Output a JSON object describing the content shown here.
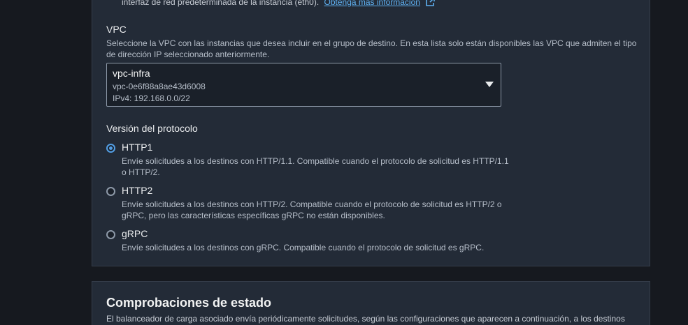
{
  "top_note": {
    "text": "interfaz de red predeterminada de la instancia (eth0).",
    "link": "Obtenga más información"
  },
  "vpc": {
    "label": "VPC",
    "description": "Seleccione la VPC con las instancias que desea incluir en el grupo de destino. En esta lista solo están disponibles las VPC que admiten el tipo de dirección IP seleccionado anteriormente.",
    "selected": {
      "name": "vpc-infra",
      "id": "vpc-0e6f88a8ae43d6008",
      "cidr": "IPv4: 192.168.0.0/22"
    }
  },
  "protocol": {
    "label": "Versión del protocolo",
    "options": [
      {
        "title": "HTTP1",
        "description": "Envíe solicitudes a los destinos con HTTP/1.1. Compatible cuando el protocolo de solicitud es HTTP/1.1 o HTTP/2.",
        "checked": true
      },
      {
        "title": "HTTP2",
        "description": "Envíe solicitudes a los destinos con HTTP/2. Compatible cuando el protocolo de solicitud es HTTP/2 o gRPC, pero las características específicas gRPC no están disponibles.",
        "checked": false
      },
      {
        "title": "gRPC",
        "description": "Envíe solicitudes a los destinos con gRPC. Compatible cuando el protocolo de solicitud es gRPC.",
        "checked": false
      }
    ]
  },
  "health_checks": {
    "title": "Comprobaciones de estado",
    "description": "El balanceador de carga asociado envía periódicamente solicitudes, según las configuraciones que aparecen a continuación, a los destinos"
  },
  "colors": {
    "background": "#16191f",
    "panel": "#232b37",
    "accent": "#539fe5",
    "link": "#5fb0f0"
  }
}
